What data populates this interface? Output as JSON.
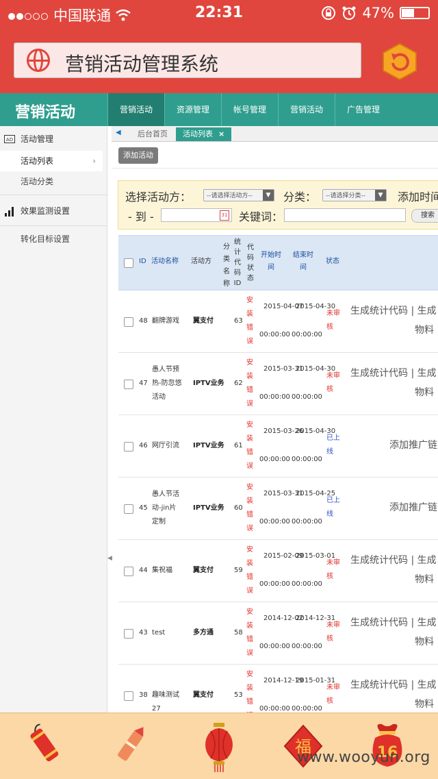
{
  "status_bar": {
    "carrier": "中国联通",
    "time": "22:31",
    "battery": "47%",
    "battery_level": 0.47
  },
  "browser": {
    "title": "营销活动管理系统",
    "globe_icon": "globe-icon",
    "refresh_icon": "refresh-icon"
  },
  "header": {
    "brand": "营销活动",
    "nav": [
      "营销活动",
      "资源管理",
      "帐号管理",
      "营销活动",
      "广告管理"
    ]
  },
  "sidebar": {
    "group1": "活动管理",
    "items1": [
      "活动列表",
      "活动分类"
    ],
    "group2": "效果监测设置",
    "items2": [
      "转化目标设置"
    ]
  },
  "tabs": {
    "home": "后台首页",
    "current": "活动列表",
    "close": "×"
  },
  "toolbar": {
    "add_label": "添加活动"
  },
  "filter": {
    "party_label": "选择活动方：",
    "party_select": "--请选择活动方--",
    "category_label": "分类：",
    "category_select": "--请选择分类--",
    "add_time_label": "添加时间",
    "to_label": "- 到 -",
    "keyword_label": "关键词：",
    "search_label": "搜索"
  },
  "table": {
    "headers": {
      "id": "ID",
      "name": "活动名称",
      "party": "活动方",
      "category": "分类名称",
      "stat_id": "统计代码ID",
      "code_status": "代码状态",
      "start": "开始时间",
      "end": "结束时间",
      "status": "状态"
    },
    "rows": [
      {
        "id": "48",
        "name": "翻牌游戏",
        "party": "翼支付",
        "stat": "63",
        "code": "安装错误",
        "start_d": "2015-04-07",
        "start_t": "00:00:00",
        "end_d": "2015-04-30",
        "end_t": "00:00:00",
        "status": "未审核",
        "op1": "生成统计代码 | 生成",
        "op2": "物料 |"
      },
      {
        "id": "47",
        "name": "愚人节预热-防忽悠活动",
        "party": "IPTV业务",
        "stat": "62",
        "code": "安装错误",
        "start_d": "2015-03-31",
        "start_t": "00:00:00",
        "end_d": "2015-04-30",
        "end_t": "00:00:00",
        "status": "未审核",
        "op1": "生成统计代码 | 生成",
        "op2": "物料 |"
      },
      {
        "id": "46",
        "name": "网厅引流",
        "party": "IPTV业务",
        "stat": "61",
        "code": "安装错误",
        "start_d": "2015-03-26",
        "start_t": "00:00:00",
        "end_d": "2015-04-30",
        "end_t": "00:00:00",
        "status": "已上线",
        "op1": "添加推广链",
        "op2": ""
      },
      {
        "id": "45",
        "name": "愚人节活动-jin片定制",
        "party": "IPTV业务",
        "stat": "60",
        "code": "安装错误",
        "start_d": "2015-03-31",
        "start_t": "00:00:00",
        "end_d": "2015-04-25",
        "end_t": "00:00:00",
        "status": "已上线",
        "op1": "添加推广链",
        "op2": ""
      },
      {
        "id": "44",
        "name": "集祝福",
        "party": "翼支付",
        "stat": "59",
        "code": "安装错误",
        "start_d": "2015-02-09",
        "start_t": "00:00:00",
        "end_d": "2015-03-01",
        "end_t": "00:00:00",
        "status": "未审核",
        "op1": "生成统计代码 | 生成",
        "op2": "物料 |"
      },
      {
        "id": "43",
        "name": "test",
        "party": "多方通",
        "stat": "58",
        "code": "安装错误",
        "start_d": "2014-12-02",
        "start_t": "00:00:00",
        "end_d": "2014-12-31",
        "end_t": "00:00:00",
        "status": "未审核",
        "op1": "生成统计代码 | 生成",
        "op2": "物料 |"
      },
      {
        "id": "38",
        "name": "趣味测试27",
        "party": "翼支付",
        "stat": "53",
        "code": "安装错误",
        "start_d": "2014-12-19",
        "start_t": "00:00:00",
        "end_d": "2015-01-31",
        "end_t": "00:00:00",
        "status": "未审核",
        "op1": "生成统计代码 | 生成",
        "op2": "物料 |"
      }
    ]
  },
  "footer": {
    "badge_number": "16",
    "fu_char": "福",
    "watermark": "www.wooyun.org"
  },
  "colors": {
    "app_red": "#e0463d",
    "teal": "#2f9e8e",
    "teal_dark": "#217e71",
    "status_red": "#e0302a",
    "status_blue": "#2f4ec0",
    "footer_bg": "#fbd8a6"
  }
}
